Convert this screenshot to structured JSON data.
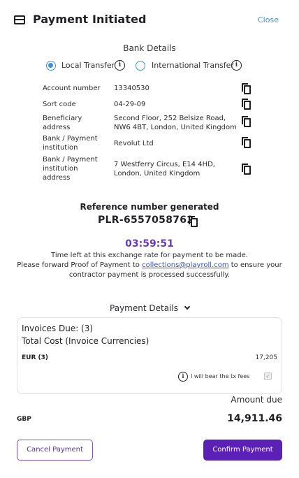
{
  "header": {
    "title": "Payment Initiated",
    "close_label": "Close"
  },
  "bank_details": {
    "title": "Bank Details",
    "transfer_options": [
      {
        "label": "Local Transfer",
        "selected": true
      },
      {
        "label": "International Transfer",
        "selected": false
      }
    ],
    "rows": [
      {
        "label": "Account number",
        "value": "13340530"
      },
      {
        "label": "Sort code",
        "value": "04-29-09"
      },
      {
        "label": "Beneficiary address",
        "value": "Second Floor, 252 Belsize Road, NW6 4BT, London, United Kingdom"
      },
      {
        "label": "Bank / Payment institution",
        "value": "Revolut Ltd"
      },
      {
        "label": "Bank / Payment institution address",
        "value": "7 Westferry Circus, E14 4HD, London, United Kingdom"
      }
    ]
  },
  "reference": {
    "label": "Reference number generated",
    "number": "PLR-6557058762"
  },
  "timer": {
    "time_left": "03:59:51",
    "line1": "Time left at this exchange rate for payment to be made.",
    "line2_prefix": "Please forward Proof of Payment to ",
    "email": "collections@playroll.com",
    "line2_suffix": " to ensure your contractor payment is processed successfully."
  },
  "payment_details": {
    "title": "Payment Details",
    "invoices_due": "Invoices Due: (3)",
    "total_cost": "Total Cost (Invoice Currencies)",
    "currency_code": "EUR (3)",
    "currency_amount": "17,205",
    "bear_fees_label": "I will bear the tx fees",
    "bear_fees_checked": true
  },
  "amount_due": {
    "label": "Amount due",
    "currency": "GBP",
    "value": "14,911.46"
  },
  "actions": {
    "cancel_label": "Cancel Payment",
    "confirm_label": "Confirm Payment"
  },
  "colors": {
    "accent": "#5b21b6",
    "timer": "#6b3bbd",
    "radio": "#3a8fe0",
    "link": "#2f4fd6",
    "close": "#4a8bd6"
  }
}
